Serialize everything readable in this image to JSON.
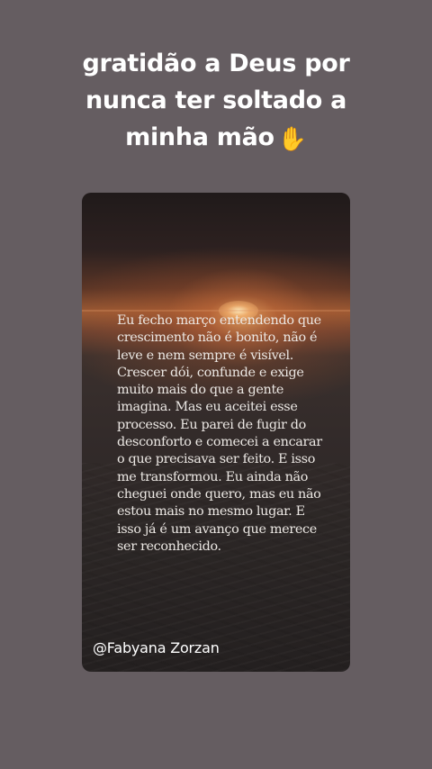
{
  "caption": {
    "line1": "gratidão a Deus por",
    "line2": "nunca ter soltado a",
    "line3": "minha mão",
    "emoji": "✋"
  },
  "card": {
    "text": "Eu fecho março entendendo que\ncrescimento não é bonito, não é\nleve e nem sempre é visível.\nCrescer dói, confunde e exige\nmuito mais do que a gente\nimagina. Mas eu aceitei esse\nprocesso. Eu parei de fugir do\ndesconforto e comecei a encarar\no que precisava ser feito. E isso\nme transformou. Eu ainda não\ncheguei onde quero, mas eu não\nestou mais no mesmo lugar. E\nisso já é um avanço que merece\nser reconhecido.",
    "author": "@Fabyana Zorzan"
  }
}
